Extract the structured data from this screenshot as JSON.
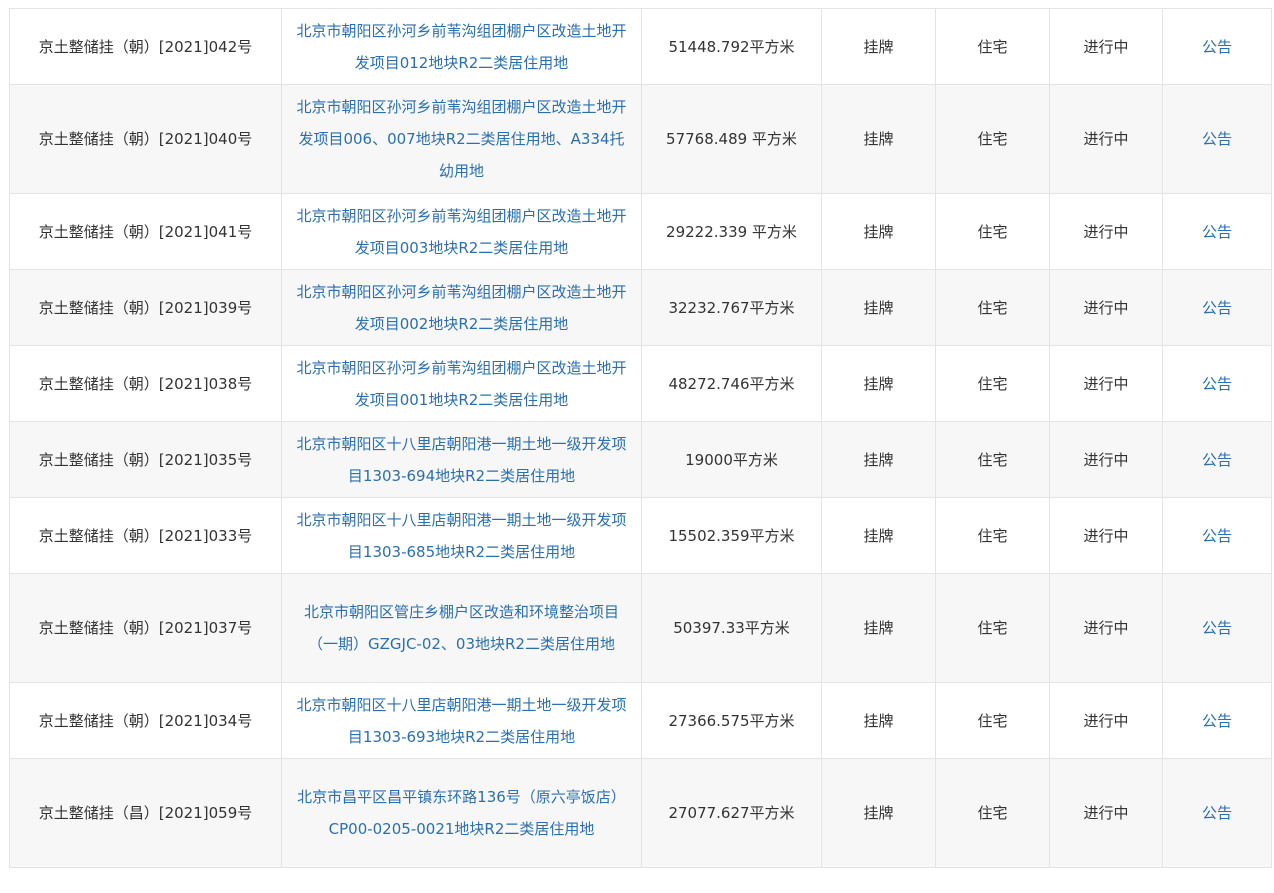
{
  "colors": {
    "link": "#2a6fb0",
    "text": "#333333",
    "border": "#e4e4e4",
    "row_alt_bg": "#f7f7f7"
  },
  "rows": [
    {
      "no": "京土整储挂（朝）[2021]042号",
      "name": "北京市朝阳区孙河乡前苇沟组团棚户区改造土地开发项目012地块R2二类居住用地",
      "area": "51448.792平方米",
      "method": "挂牌",
      "use": "住宅",
      "status": "进行中",
      "notice": "公告"
    },
    {
      "no": "京土整储挂（朝）[2021]040号",
      "name": "北京市朝阳区孙河乡前苇沟组团棚户区改造土地开发项目006、007地块R2二类居住用地、A334托幼用地",
      "area": "57768.489 平方米",
      "method": "挂牌",
      "use": "住宅",
      "status": "进行中",
      "notice": "公告"
    },
    {
      "no": "京土整储挂（朝）[2021]041号",
      "name": "北京市朝阳区孙河乡前苇沟组团棚户区改造土地开发项目003地块R2二类居住用地",
      "area": "29222.339 平方米",
      "method": "挂牌",
      "use": "住宅",
      "status": "进行中",
      "notice": "公告"
    },
    {
      "no": "京土整储挂（朝）[2021]039号",
      "name": "北京市朝阳区孙河乡前苇沟组团棚户区改造土地开发项目002地块R2二类居住用地",
      "area": "32232.767平方米",
      "method": "挂牌",
      "use": "住宅",
      "status": "进行中",
      "notice": "公告"
    },
    {
      "no": "京土整储挂（朝）[2021]038号",
      "name": "北京市朝阳区孙河乡前苇沟组团棚户区改造土地开发项目001地块R2二类居住用地",
      "area": "48272.746平方米",
      "method": "挂牌",
      "use": "住宅",
      "status": "进行中",
      "notice": "公告"
    },
    {
      "no": "京土整储挂（朝）[2021]035号",
      "name": "北京市朝阳区十八里店朝阳港一期土地一级开发项目1303-694地块R2二类居住用地",
      "area": "19000平方米",
      "method": "挂牌",
      "use": "住宅",
      "status": "进行中",
      "notice": "公告"
    },
    {
      "no": "京土整储挂（朝）[2021]033号",
      "name": "北京市朝阳区十八里店朝阳港一期土地一级开发项目1303-685地块R2二类居住用地",
      "area": "15502.359平方米",
      "method": "挂牌",
      "use": "住宅",
      "status": "进行中",
      "notice": "公告"
    },
    {
      "no": "京土整储挂（朝）[2021]037号",
      "name": "北京市朝阳区管庄乡棚户区改造和环境整治项目（一期）GZGJC-02、03地块R2二类居住用地",
      "area": "50397.33平方米",
      "method": "挂牌",
      "use": "住宅",
      "status": "进行中",
      "notice": "公告"
    },
    {
      "no": "京土整储挂（朝）[2021]034号",
      "name": "北京市朝阳区十八里店朝阳港一期土地一级开发项目1303-693地块R2二类居住用地",
      "area": "27366.575平方米",
      "method": "挂牌",
      "use": "住宅",
      "status": "进行中",
      "notice": "公告"
    },
    {
      "no": "京土整储挂（昌）[2021]059号",
      "name": "北京市昌平区昌平镇东环路136号（原六亭饭店）CP00-0205-0021地块R2二类居住用地",
      "area": "27077.627平方米",
      "method": "挂牌",
      "use": "住宅",
      "status": "进行中",
      "notice": "公告"
    }
  ]
}
